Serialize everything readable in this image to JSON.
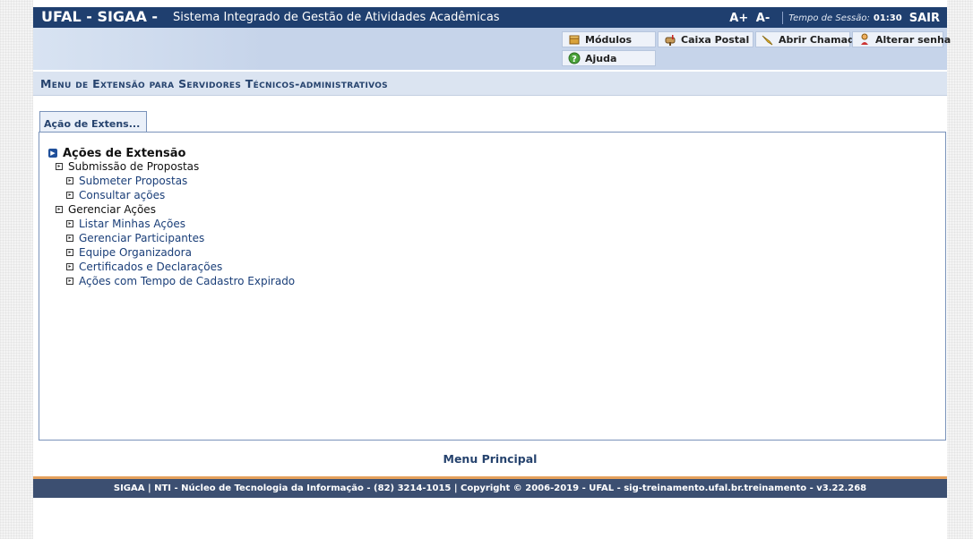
{
  "topbar": {
    "brand": "UFAL - SIGAA -",
    "system_name": "Sistema Integrado de Gestão de Atividades Acadêmicas",
    "font_increase": "A+",
    "font_decrease": "A-",
    "session_label": "Tempo de Sessão:",
    "session_time": "01:30",
    "logout": "SAIR"
  },
  "shortcuts": {
    "modulos": "Módulos",
    "caixa_postal": "Caixa Postal",
    "abrir_chamado": "Abrir Chamado",
    "alterar_senha": "Alterar senha",
    "ajuda": "Ajuda"
  },
  "page_title": "Menu de Extensão para Servidores Técnicos-administrativos",
  "tab_label": "Ação de Extens...",
  "menu": {
    "root": "Ações de Extensão",
    "group1": "Submissão de Propostas",
    "group1_items": [
      "Submeter Propostas",
      "Consultar ações"
    ],
    "group2": "Gerenciar Ações",
    "group2_items": [
      "Listar Minhas Ações",
      "Gerenciar Participantes",
      "Equipe Organizadora",
      "Certificados e Declarações",
      "Ações com Tempo de Cadastro Expirado"
    ]
  },
  "menu_principal": "Menu Principal",
  "footer": "SIGAA | NTI - Núcleo de Tecnologia da Informação - (82) 3214-1015 | Copyright © 2006-2019 - UFAL - sig-treinamento.ufal.br.treinamento - v3.22.268",
  "colors": {
    "topbar": "#1f3f6f",
    "header_band": "#c6d4ea",
    "title_text": "#26436e",
    "footer": "#3c4f71",
    "footer_accent": "#e5a15c"
  }
}
